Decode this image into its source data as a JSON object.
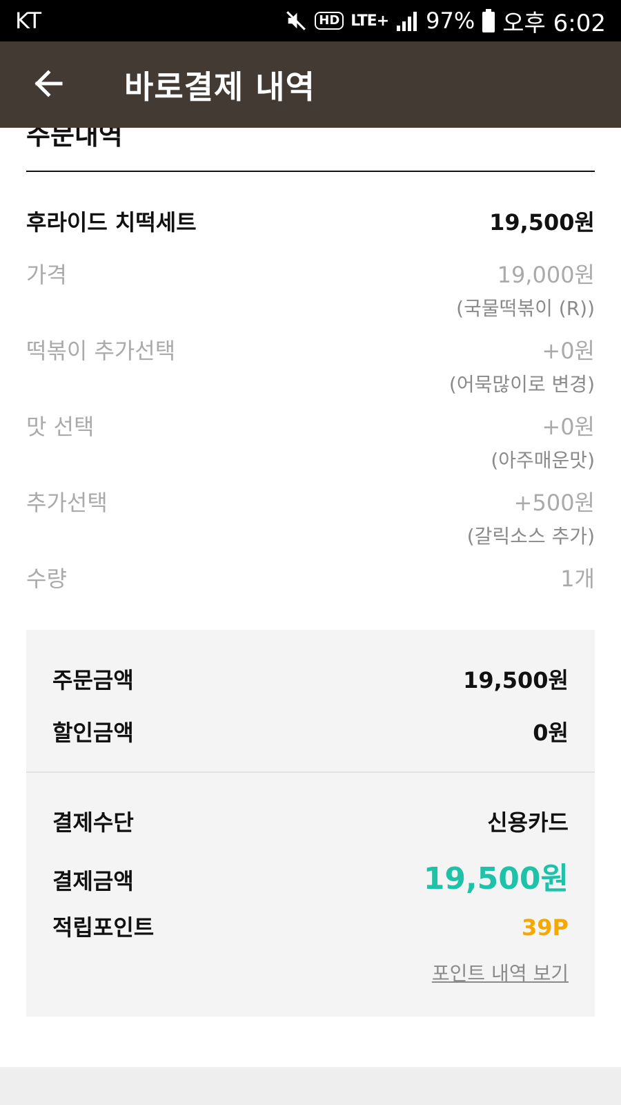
{
  "colors": {
    "status_bar_bg": "#000000",
    "app_bar_bg": "#433a33",
    "accent_teal": "#1fc2a8",
    "accent_orange": "#f5a800",
    "muted_text": "#aaaaaa",
    "summary_bg": "#f4f4f4"
  },
  "status_bar": {
    "carrier": "KT",
    "icons": [
      "mute-icon",
      "hd-voice-icon",
      "lte-plus-icon",
      "signal-icon",
      "battery-icon"
    ],
    "hd_label": "HD",
    "lte_label": "LTE+",
    "battery": "97%",
    "time": "오후 6:02"
  },
  "app_bar": {
    "title": "바로결제 내역",
    "back_icon": "arrow-left-icon"
  },
  "order": {
    "section_title": "주문내역",
    "product": {
      "name": "후라이드 치떡세트",
      "price": "19,500원"
    },
    "options": [
      {
        "label": "가격",
        "price": "19,000원",
        "detail": "(국물떡볶이 (R))"
      },
      {
        "label": "떡볶이 추가선택",
        "price": "+0원",
        "detail": "(어묵많이로 변경)"
      },
      {
        "label": "맛 선택",
        "price": "+0원",
        "detail": "(아주매운맛)"
      },
      {
        "label": "추가선택",
        "price": "+500원",
        "detail": "(갈릭소스 추가)"
      },
      {
        "label": "수량",
        "price": "1개",
        "detail": ""
      }
    ]
  },
  "summary": {
    "order_amount_label": "주문금액",
    "order_amount": "19,500원",
    "discount_label": "할인금액",
    "discount": "0원",
    "method_label": "결제수단",
    "method": "신용카드",
    "pay_label": "결제금액",
    "pay_amount": "19,500원",
    "points_label": "적립포인트",
    "points": "39P",
    "points_link": "포인트 내역 보기"
  }
}
